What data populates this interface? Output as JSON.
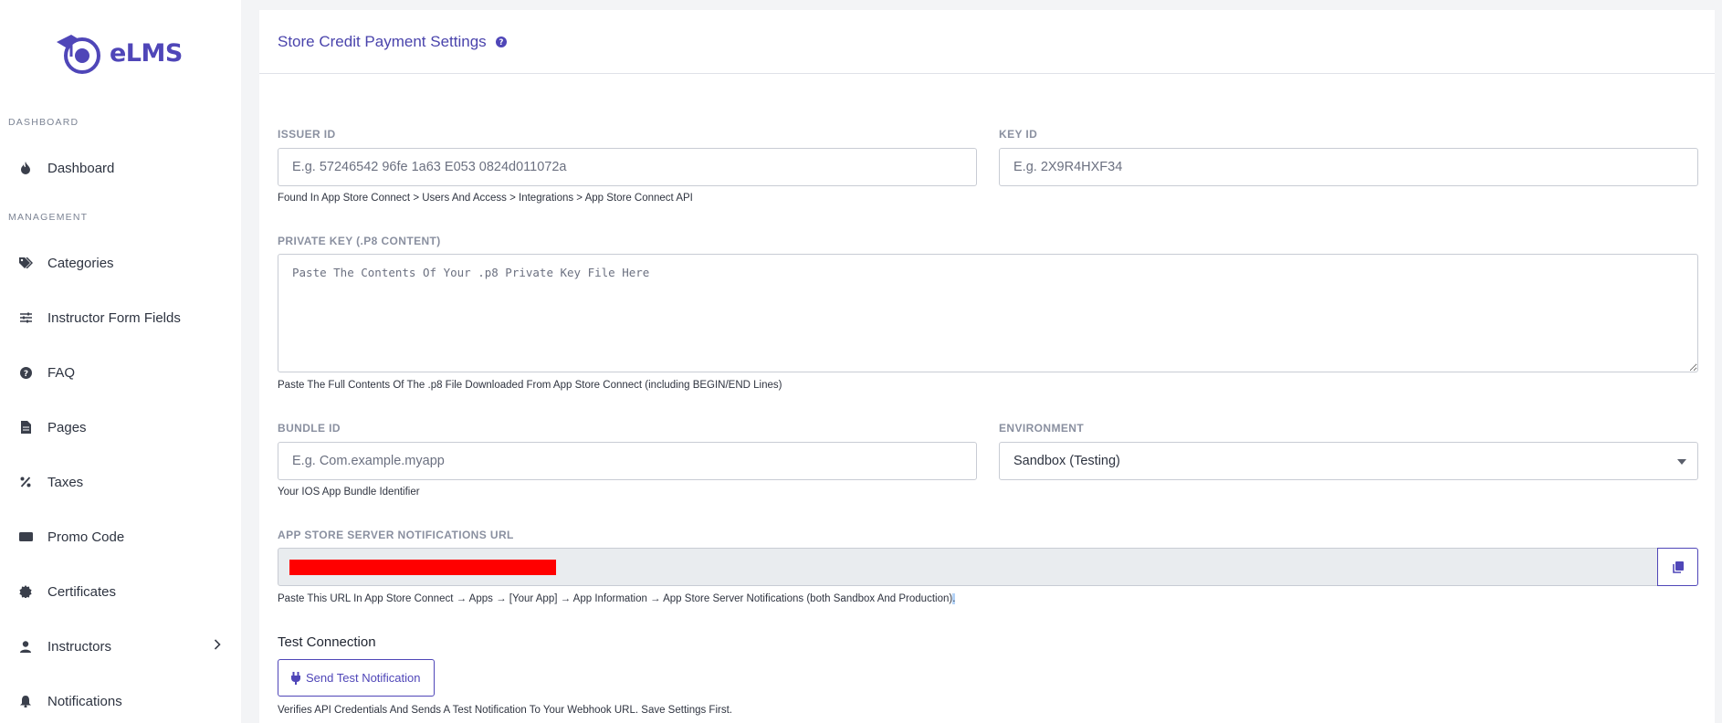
{
  "app": {
    "name": "eLMS"
  },
  "sidebar": {
    "sections": [
      {
        "label": "DASHBOARD"
      },
      {
        "label": "MANAGEMENT"
      }
    ],
    "items": [
      {
        "label": "Dashboard",
        "icon": "fire-icon"
      },
      {
        "label": "Categories",
        "icon": "tags-icon"
      },
      {
        "label": "Instructor Form Fields",
        "icon": "sliders-icon"
      },
      {
        "label": "FAQ",
        "icon": "question-circle-icon"
      },
      {
        "label": "Pages",
        "icon": "file-icon"
      },
      {
        "label": "Taxes",
        "icon": "percent-icon"
      },
      {
        "label": "Promo Code",
        "icon": "ticket-icon"
      },
      {
        "label": "Certificates",
        "icon": "certificate-icon"
      },
      {
        "label": "Instructors",
        "icon": "user-icon",
        "has_submenu": true
      },
      {
        "label": "Notifications",
        "icon": "bell-icon"
      }
    ]
  },
  "page": {
    "title": "Store Credit Payment Settings"
  },
  "form": {
    "issuer_id": {
      "label": "ISSUER ID",
      "placeholder": "E.g. 57246542 96fe 1a63 E053 0824d011072a",
      "value": "",
      "help": "Found In App Store Connect > Users And Access > Integrations > App Store Connect API"
    },
    "key_id": {
      "label": "KEY ID",
      "placeholder": "E.g. 2X9R4HXF34",
      "value": ""
    },
    "private_key": {
      "label": "PRIVATE KEY (.P8 CONTENT)",
      "placeholder": "Paste The Contents Of Your .p8 Private Key File Here",
      "value": "",
      "help": "Paste The Full Contents Of The .p8 File Downloaded From App Store Connect (including BEGIN/END Lines)"
    },
    "bundle_id": {
      "label": "BUNDLE ID",
      "placeholder": "E.g. Com.example.myapp",
      "value": "",
      "help": "Your IOS App Bundle Identifier"
    },
    "environment": {
      "label": "ENVIRONMENT",
      "selected": "Sandbox (Testing)"
    },
    "notifications_url": {
      "label": "APP STORE SERVER NOTIFICATIONS URL",
      "help": "Paste This URL In App Store Connect → Apps → [Your App] → App Information → App Store Server Notifications (both Sandbox And Production)",
      "help_end": "."
    }
  },
  "test_connection": {
    "title": "Test Connection",
    "button_label": "Send Test Notification",
    "help": "Verifies API Credentials And Sends A Test Notification To Your Webhook URL. Save Settings First."
  },
  "colors": {
    "accent": "#4f46b8",
    "redaction": "#ff0000"
  }
}
